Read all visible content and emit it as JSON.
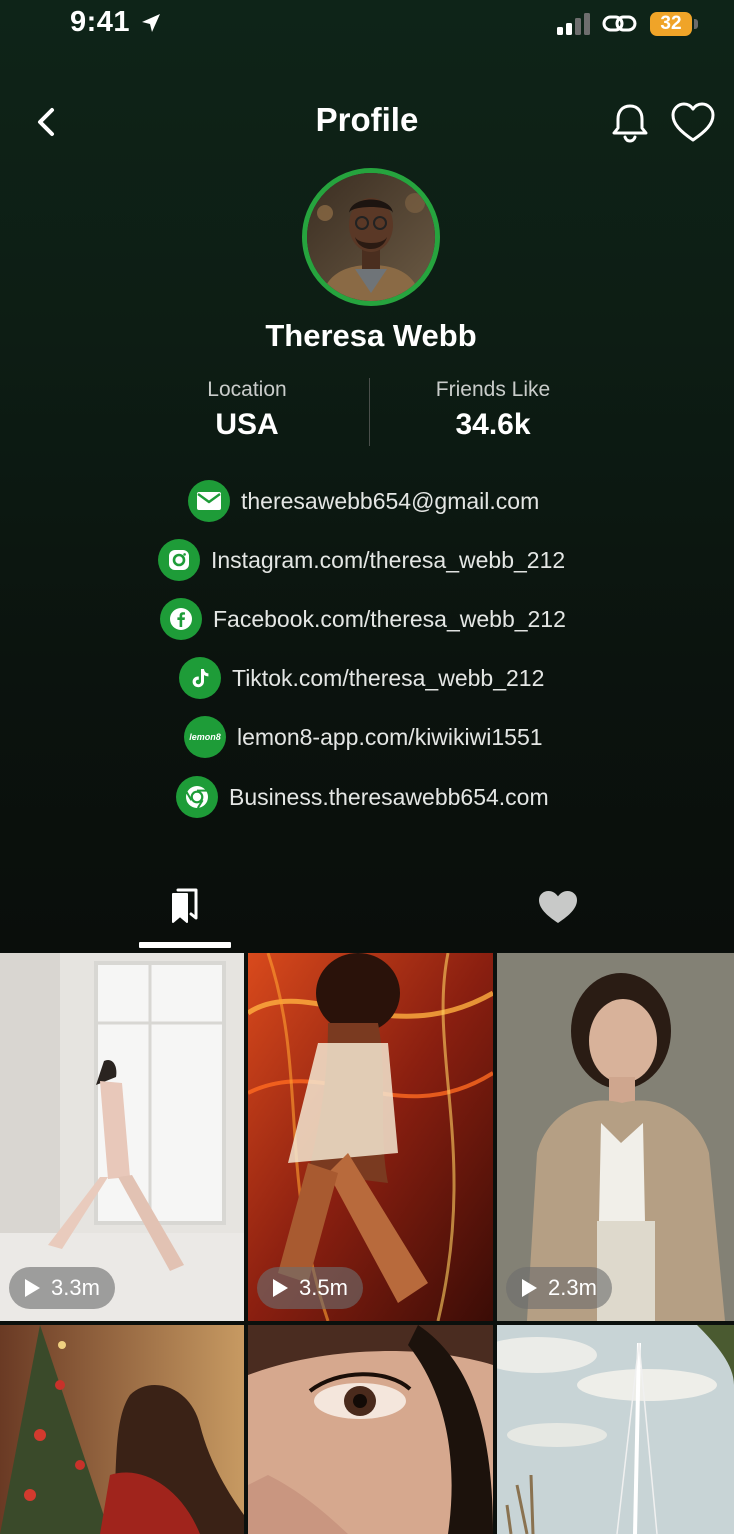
{
  "status_bar": {
    "time": "9:41",
    "battery": "32",
    "icons": [
      "location-arrow-icon",
      "cellular-signal-icon",
      "link-icon",
      "battery-icon"
    ]
  },
  "header": {
    "title": "Profile",
    "icons": [
      "back-chevron-icon",
      "bell-icon",
      "heart-outline-icon"
    ]
  },
  "profile": {
    "name": "Theresa Webb",
    "avatar": "profile-photo",
    "stats": [
      {
        "label": "Location",
        "value": "USA"
      },
      {
        "label": "Friends Like",
        "value": "34.6k"
      }
    ],
    "links": [
      {
        "icon": "mail-icon",
        "text": "theresawebb654@gmail.com"
      },
      {
        "icon": "instagram-icon",
        "text": "Instagram.com/theresa_webb_212"
      },
      {
        "icon": "facebook-icon",
        "text": "Facebook.com/theresa_webb_212"
      },
      {
        "icon": "tiktok-icon",
        "text": "Tiktok.com/theresa_webb_212"
      },
      {
        "icon": "lemon8-icon",
        "text": "lemon8-app.com/kiwikiwi1551",
        "icon_text": "lemon8"
      },
      {
        "icon": "chrome-icon",
        "text": "Business.theresawebb654.com"
      }
    ]
  },
  "tabs": [
    {
      "icon": "bookmarks-icon",
      "active": true
    },
    {
      "icon": "heart-filled-icon",
      "active": false
    }
  ],
  "grid": [
    {
      "image": "woman walking in white room",
      "views": "3.3m"
    },
    {
      "image": "dancer with light trails",
      "views": "3.5m"
    },
    {
      "image": "woman in beige blazer",
      "views": "2.3m"
    },
    {
      "image": "woman by christmas tree",
      "views": ""
    },
    {
      "image": "close-up face eyelashes",
      "views": ""
    },
    {
      "image": "sailboat mast and sky",
      "views": ""
    }
  ],
  "colors": {
    "accent_green": "#26a43e",
    "icon_green": "#1e9c38",
    "battery": "#f0a428"
  }
}
